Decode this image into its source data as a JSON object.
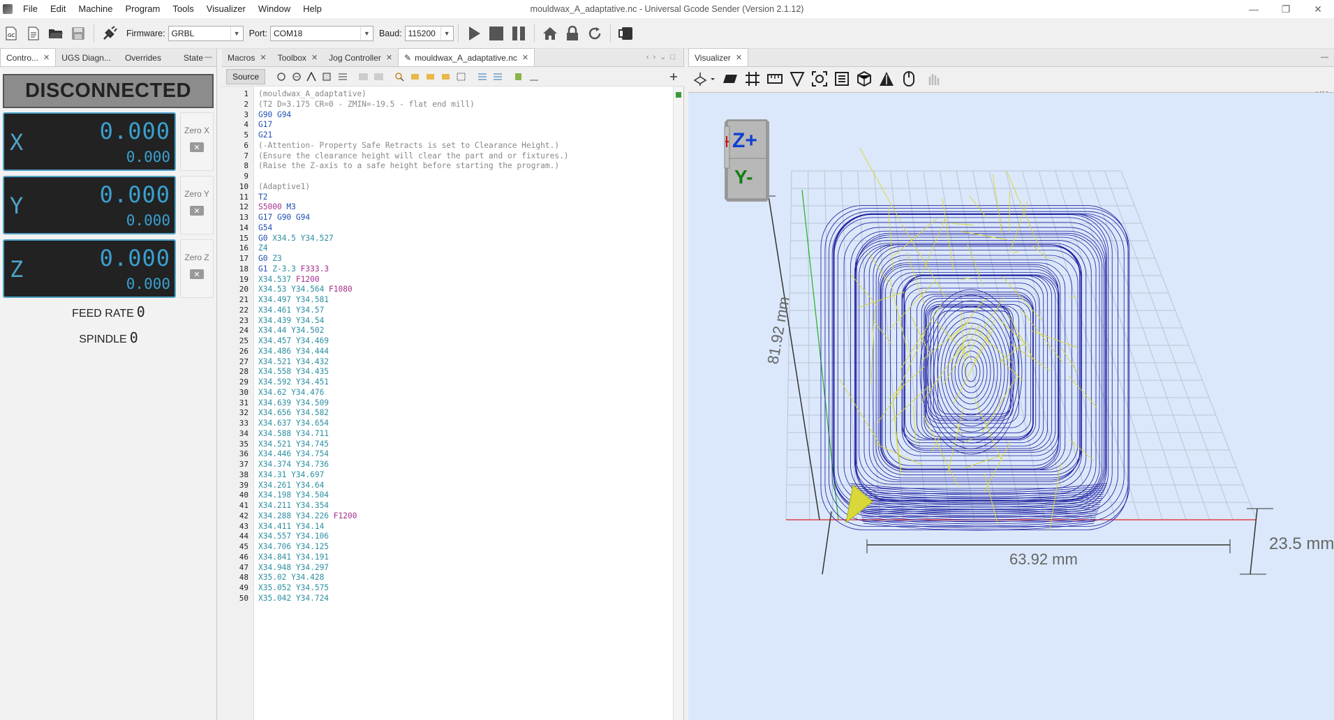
{
  "window": {
    "title": "mouldwax_A_adaptative.nc - Universal Gcode Sender (Version 2.1.12)",
    "controls": [
      "—",
      "❐",
      "✕"
    ]
  },
  "menu": [
    "File",
    "Edit",
    "Machine",
    "Program",
    "Tools",
    "Visualizer",
    "Window",
    "Help"
  ],
  "toolbar": {
    "firmware_label": "Firmware:",
    "firmware_value": "GRBL",
    "port_label": "Port:",
    "port_value": "COM18",
    "baud_label": "Baud:",
    "baud_value": "115200"
  },
  "left_panel": {
    "tabs": [
      "Contro...",
      "UGS Diagn...",
      "Overrides",
      "State"
    ],
    "status": "DISCONNECTED",
    "axes": [
      {
        "axis": "X",
        "work": "0.000",
        "machine": "0.000",
        "zero_label": "Zero X"
      },
      {
        "axis": "Y",
        "work": "0.000",
        "machine": "0.000",
        "zero_label": "Zero Y"
      },
      {
        "axis": "Z",
        "work": "0.000",
        "machine": "0.000",
        "zero_label": "Zero Z"
      }
    ],
    "feed_rate_label": "FEED RATE",
    "feed_rate_value": "0",
    "spindle_label": "SPINDLE",
    "spindle_value": "0"
  },
  "editor": {
    "tabs": [
      "Macros",
      "Toolbox",
      "Jog Controller",
      "mouldwax_A_adaptative.nc"
    ],
    "source_label": "Source",
    "lines": [
      "(mouldwax_A_adaptative)",
      "(T2 D=3.175 CR=0 - ZMIN=-19.5 - flat end mill)",
      "G90 G94",
      "G17",
      "G21",
      "(-Attention- Property Safe Retracts is set to Clearance Height.)",
      "(Ensure the clearance height will clear the part and or fixtures.)",
      "(Raise the Z-axis to a safe height before starting the program.)",
      "",
      "(Adaptive1)",
      "T2",
      "S5000 M3",
      "G17 G90 G94",
      "G54",
      "G0 X34.5 Y34.527",
      "Z4",
      "G0 Z3",
      "G1 Z-3.3 F333.3",
      "X34.537 F1200",
      "X34.53 Y34.564 F1080",
      "X34.497 Y34.581",
      "X34.461 Y34.57",
      "X34.439 Y34.54",
      "X34.44 Y34.502",
      "X34.457 Y34.469",
      "X34.486 Y34.444",
      "X34.521 Y34.432",
      "X34.558 Y34.435",
      "X34.592 Y34.451",
      "X34.62 Y34.476",
      "X34.639 Y34.509",
      "X34.656 Y34.582",
      "X34.637 Y34.654",
      "X34.588 Y34.711",
      "X34.521 Y34.745",
      "X34.446 Y34.754",
      "X34.374 Y34.736",
      "X34.31 Y34.697",
      "X34.261 Y34.64",
      "X34.198 Y34.504",
      "X34.211 Y34.354",
      "X34.288 Y34.226 F1200",
      "X34.411 Y34.14",
      "X34.557 Y34.106",
      "X34.706 Y34.125",
      "X34.841 Y34.191",
      "X34.948 Y34.297",
      "X35.02 Y34.428",
      "X35.052 Y34.575",
      "X35.042 Y34.724"
    ]
  },
  "visualizer": {
    "tab": "Visualizer",
    "units_label": "MM",
    "cube_top": "Z+",
    "cube_front": "Y-",
    "dim_y": "81.92 mm",
    "dim_x": "63.92 mm",
    "dim_z": "23.5 mm",
    "colors": {
      "toolpath": "#1a1a9c",
      "rapid": "#d8d83a",
      "x_axis": "#e02020",
      "y_axis": "#20b020",
      "background": "#dbe8fb"
    }
  }
}
